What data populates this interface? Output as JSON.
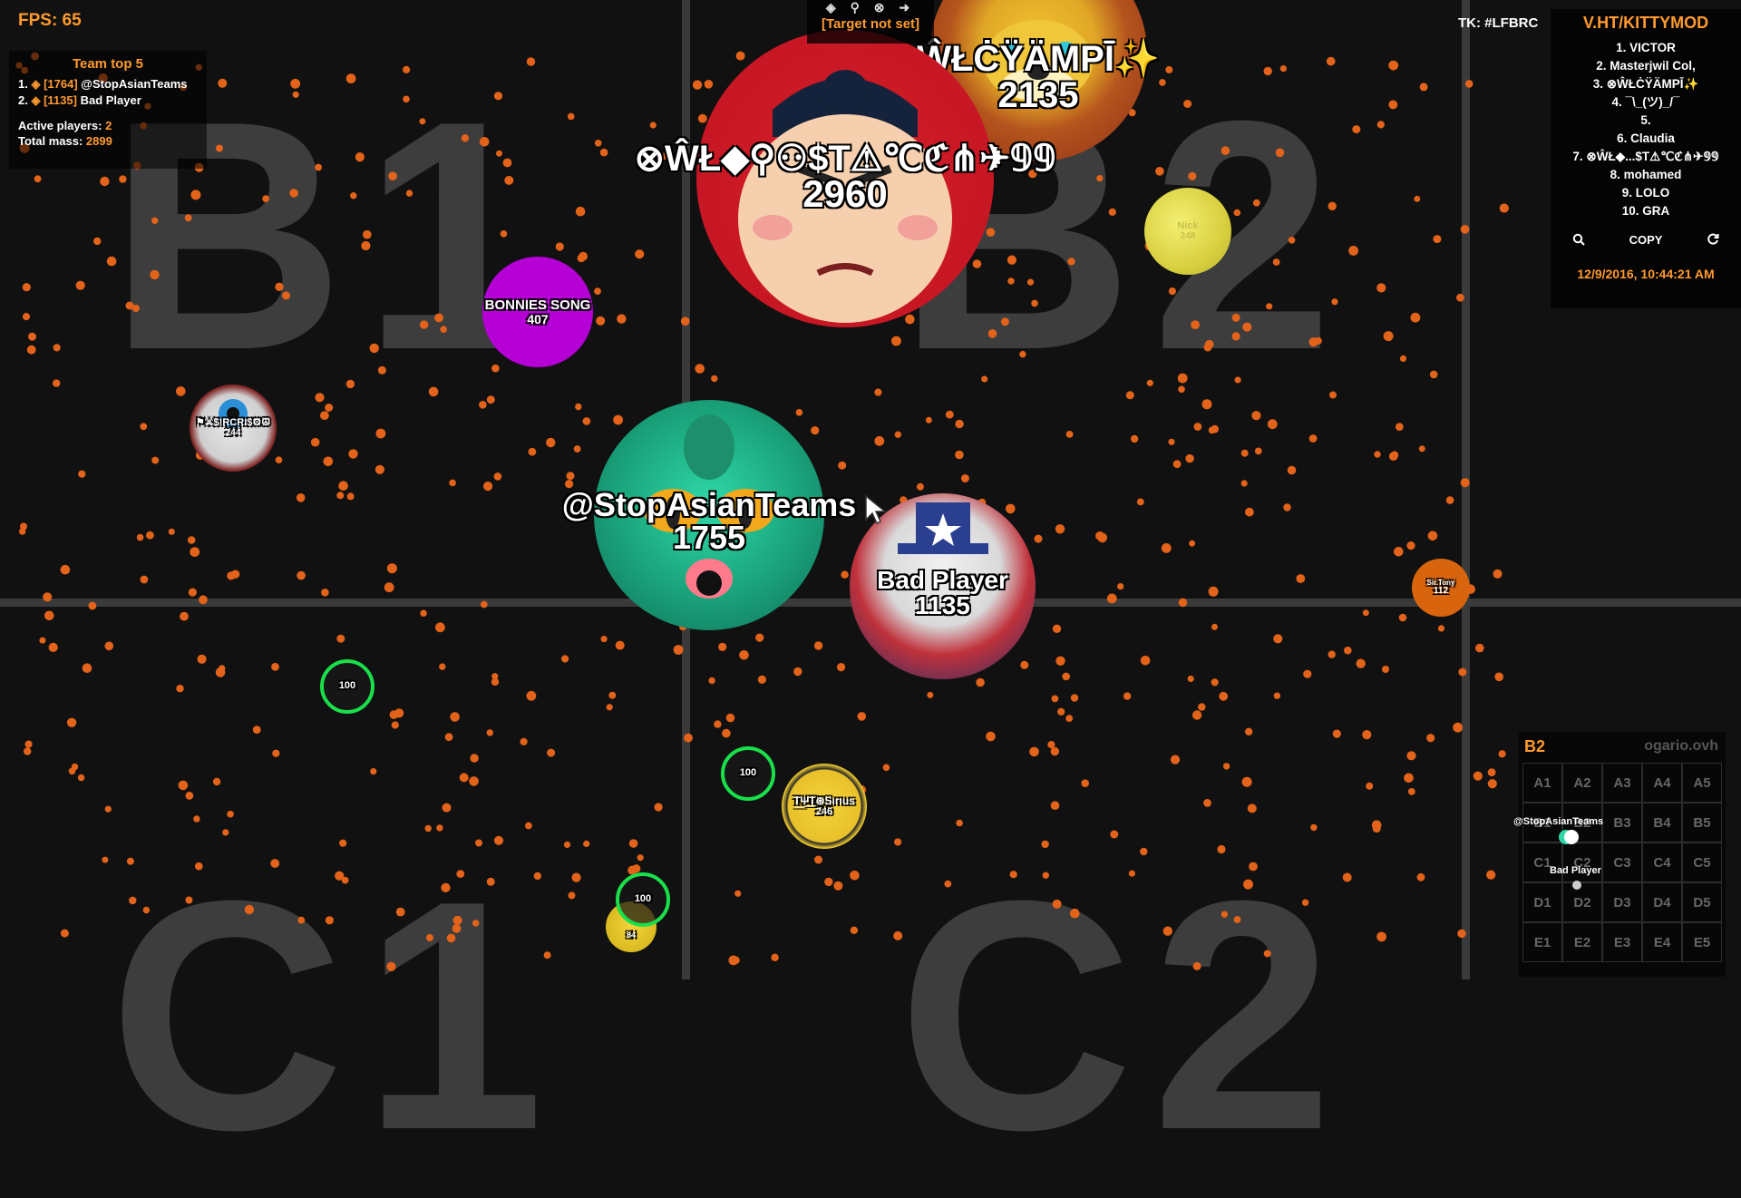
{
  "hud": {
    "fps": "FPS: 65",
    "team_title": "Team top 5",
    "team_members": [
      {
        "rank": "1.",
        "mass": "[1764]",
        "name": "@StopAsianTeams"
      },
      {
        "rank": "2.",
        "mass": "[1135]",
        "name": "Bad Player"
      }
    ],
    "active_players_label": "Active players:",
    "active_players_value": "2",
    "total_mass_label": "Total mass:",
    "total_mass_value": "2899",
    "target_text": "[Target not set]",
    "target_icons": "◈ ⚲ ⊗ ➜",
    "tk": "TK: #LFBRC",
    "timestamp": "12/9/2016, 10:44:21 AM"
  },
  "leaderboard": {
    "title": "V.HT/KITTYMOD",
    "entries": [
      "1. VICTOR",
      "2. Masterjwil Col,",
      "3. ⊗ŴŁĊŸÄMPĪ✨",
      "4. ¯\\_(ツ)_/¯",
      "5.",
      "6. Claudia",
      "7. ⊗ŴŁ◆...$T⚠℃ℭ⋔✈𝟡𝟡",
      "8. mohamed",
      "9. LOLO",
      "10. GRA"
    ],
    "copy_label": "COPY",
    "search_icon": "search-icon",
    "refresh_icon": "refresh-icon"
  },
  "sectors": [
    "B1",
    "B2",
    "C1",
    "C2"
  ],
  "cells": {
    "sumo": {
      "name": "⊗ŴŁ◆⚲⚇$T⚠℃ℭ⋔✈𝟡𝟡",
      "mass": "2960"
    },
    "lion": {
      "name": "ŴŁĊŸÄMPĪ✨",
      "mass": "2135"
    },
    "bonnie": {
      "name": "BONNIES SONG",
      "mass": "407"
    },
    "nick": {
      "name": "Nick",
      "mass": "248"
    },
    "sircris": {
      "name": "⚑⚔$!RCRI$⚙☮",
      "mass": "244"
    },
    "player": {
      "name": "@StopAsianTeams",
      "mass": "1755"
    },
    "bad": {
      "name": "Bad Player",
      "mass": "1135"
    },
    "sir": {
      "name": "Sir.Tony",
      "mass": "112"
    },
    "virus1": {
      "mass": "100"
    },
    "virus2": {
      "mass": "100"
    },
    "virus3": {
      "mass": "100"
    },
    "sirius": {
      "name": "T͟Ψ͟T⊛Sırıus",
      "mass": "246"
    },
    "small": {
      "name": "",
      "mass": "84"
    }
  },
  "minimap": {
    "sector": "B2",
    "site": "ogario.ovh",
    "cells": [
      "A1",
      "A2",
      "A3",
      "A4",
      "A5",
      "B1",
      "B2",
      "B3",
      "B4",
      "B5",
      "C1",
      "C2",
      "C3",
      "C4",
      "C5",
      "D1",
      "D2",
      "D3",
      "D4",
      "D5",
      "E1",
      "E2",
      "E3",
      "E4",
      "E5"
    ],
    "player1": "@StopAsianTeams",
    "player2": "Bad Player"
  },
  "colors": {
    "accent": "#ff9a2e",
    "food": "#e3631a",
    "virus_ring": "#19e04a",
    "bonnie": "#b500d6",
    "sir_tony": "#d8640e"
  }
}
